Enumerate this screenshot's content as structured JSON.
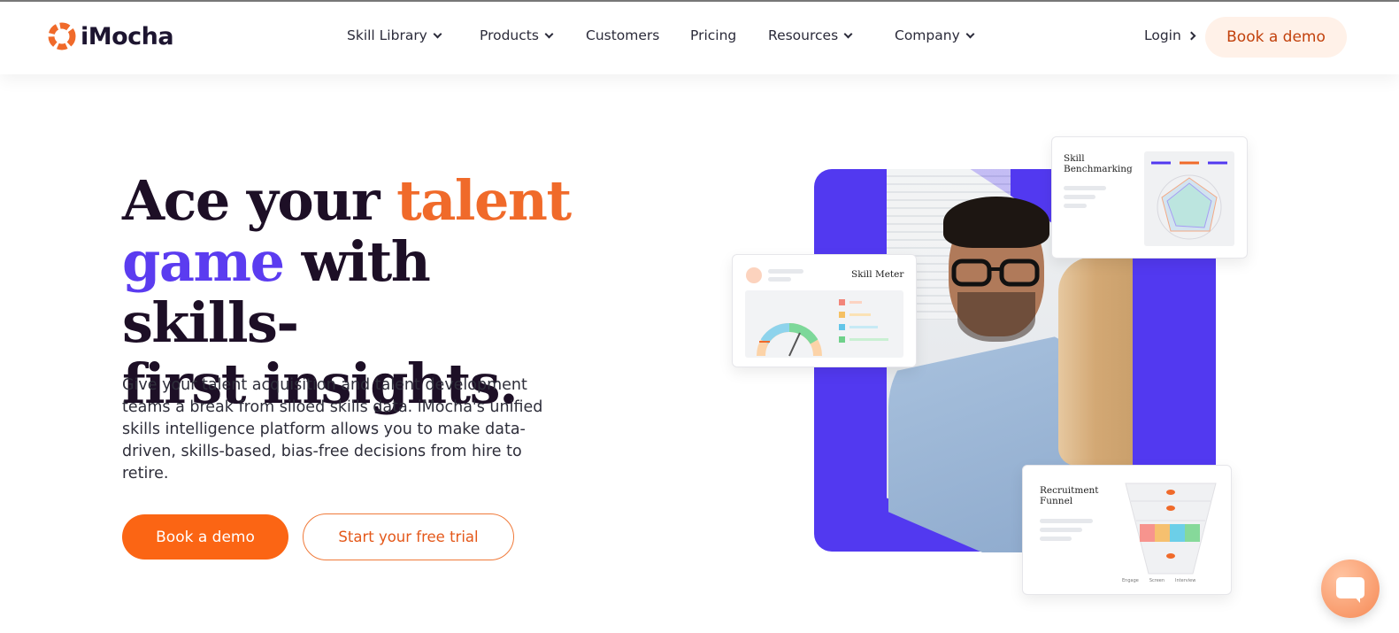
{
  "brand": {
    "name": "iMocha",
    "accent": "#fb6514",
    "purple": "#5b3cf0"
  },
  "nav": {
    "items": [
      {
        "label": "Skill Library",
        "dropdown": true
      },
      {
        "label": "Products",
        "dropdown": true
      },
      {
        "label": "Customers",
        "dropdown": false
      },
      {
        "label": "Pricing",
        "dropdown": false
      },
      {
        "label": "Resources",
        "dropdown": true
      },
      {
        "label": "Company",
        "dropdown": true
      }
    ],
    "login_label": "Login",
    "cta_label": "Book a demo"
  },
  "hero": {
    "title_part1": "Ace your ",
    "title_accent1": "talent",
    "title_accent2": "game",
    "title_part2": " with skills-",
    "title_part3": "first insights.",
    "description": "Give your talent acquisition and talent development teams a break from siloed skills data. iMocha's unified skills intelligence platform allows you to make data-driven, skills-based, bias-free decisions from hire to retire.",
    "primary_cta": "Book a demo",
    "secondary_cta": "Start your free trial"
  },
  "cards": {
    "skill_benchmarking": {
      "title": "Skill Benchmarking"
    },
    "skill_meter": {
      "title": "Skill Meter"
    },
    "recruitment_funnel": {
      "title": "Recruitment Funnel",
      "legend": [
        "Engage",
        "Screen",
        "Interview"
      ]
    }
  },
  "chat": {
    "icon": "chat-bubble-icon"
  }
}
